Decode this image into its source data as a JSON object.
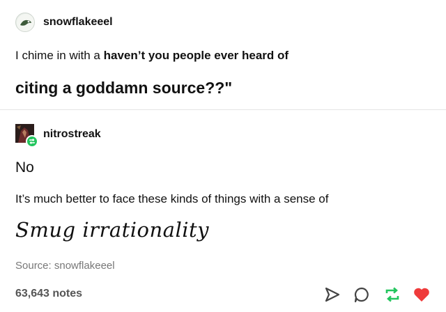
{
  "post": {
    "op": {
      "username": "snowflakeeel",
      "text_plain": "I chime in with a ",
      "text_bold": "haven’t you people ever heard of",
      "emphasis": "citing a goddamn source??\""
    },
    "reblog": {
      "username": "nitrostreak",
      "line1": "No",
      "line2": "It’s much better to face these kinds of things with a sense of",
      "fancy": "Smug irrationality"
    },
    "source": "Source: snowflakeeel",
    "notes": "63,643 notes"
  },
  "colors": {
    "reblog_green": "#23c55e",
    "like_red": "#ef3b3b"
  },
  "icons": [
    "send-icon",
    "reply-icon",
    "reblog-icon",
    "heart-icon"
  ]
}
